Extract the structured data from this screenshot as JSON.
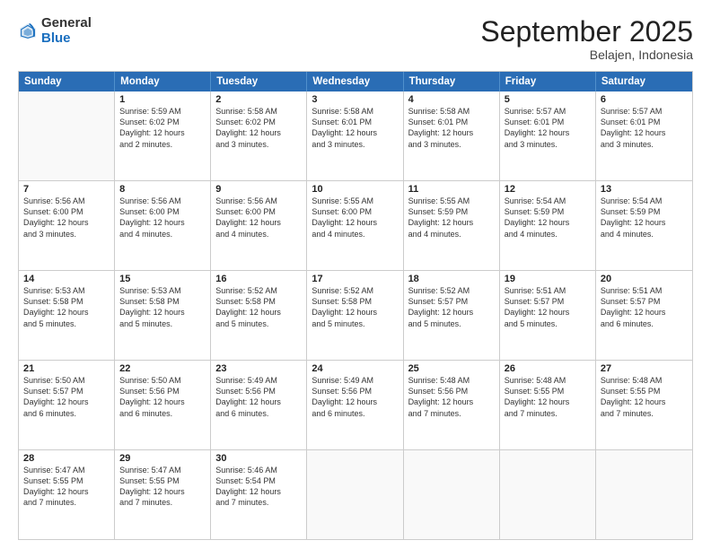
{
  "header": {
    "logo_general": "General",
    "logo_blue": "Blue",
    "title": "September 2025",
    "location": "Belajen, Indonesia"
  },
  "days_of_week": [
    "Sunday",
    "Monday",
    "Tuesday",
    "Wednesday",
    "Thursday",
    "Friday",
    "Saturday"
  ],
  "weeks": [
    [
      {
        "day": "",
        "lines": []
      },
      {
        "day": "1",
        "lines": [
          "Sunrise: 5:59 AM",
          "Sunset: 6:02 PM",
          "Daylight: 12 hours",
          "and 2 minutes."
        ]
      },
      {
        "day": "2",
        "lines": [
          "Sunrise: 5:58 AM",
          "Sunset: 6:02 PM",
          "Daylight: 12 hours",
          "and 3 minutes."
        ]
      },
      {
        "day": "3",
        "lines": [
          "Sunrise: 5:58 AM",
          "Sunset: 6:01 PM",
          "Daylight: 12 hours",
          "and 3 minutes."
        ]
      },
      {
        "day": "4",
        "lines": [
          "Sunrise: 5:58 AM",
          "Sunset: 6:01 PM",
          "Daylight: 12 hours",
          "and 3 minutes."
        ]
      },
      {
        "day": "5",
        "lines": [
          "Sunrise: 5:57 AM",
          "Sunset: 6:01 PM",
          "Daylight: 12 hours",
          "and 3 minutes."
        ]
      },
      {
        "day": "6",
        "lines": [
          "Sunrise: 5:57 AM",
          "Sunset: 6:01 PM",
          "Daylight: 12 hours",
          "and 3 minutes."
        ]
      }
    ],
    [
      {
        "day": "7",
        "lines": [
          "Sunrise: 5:56 AM",
          "Sunset: 6:00 PM",
          "Daylight: 12 hours",
          "and 3 minutes."
        ]
      },
      {
        "day": "8",
        "lines": [
          "Sunrise: 5:56 AM",
          "Sunset: 6:00 PM",
          "Daylight: 12 hours",
          "and 4 minutes."
        ]
      },
      {
        "day": "9",
        "lines": [
          "Sunrise: 5:56 AM",
          "Sunset: 6:00 PM",
          "Daylight: 12 hours",
          "and 4 minutes."
        ]
      },
      {
        "day": "10",
        "lines": [
          "Sunrise: 5:55 AM",
          "Sunset: 6:00 PM",
          "Daylight: 12 hours",
          "and 4 minutes."
        ]
      },
      {
        "day": "11",
        "lines": [
          "Sunrise: 5:55 AM",
          "Sunset: 5:59 PM",
          "Daylight: 12 hours",
          "and 4 minutes."
        ]
      },
      {
        "day": "12",
        "lines": [
          "Sunrise: 5:54 AM",
          "Sunset: 5:59 PM",
          "Daylight: 12 hours",
          "and 4 minutes."
        ]
      },
      {
        "day": "13",
        "lines": [
          "Sunrise: 5:54 AM",
          "Sunset: 5:59 PM",
          "Daylight: 12 hours",
          "and 4 minutes."
        ]
      }
    ],
    [
      {
        "day": "14",
        "lines": [
          "Sunrise: 5:53 AM",
          "Sunset: 5:58 PM",
          "Daylight: 12 hours",
          "and 5 minutes."
        ]
      },
      {
        "day": "15",
        "lines": [
          "Sunrise: 5:53 AM",
          "Sunset: 5:58 PM",
          "Daylight: 12 hours",
          "and 5 minutes."
        ]
      },
      {
        "day": "16",
        "lines": [
          "Sunrise: 5:52 AM",
          "Sunset: 5:58 PM",
          "Daylight: 12 hours",
          "and 5 minutes."
        ]
      },
      {
        "day": "17",
        "lines": [
          "Sunrise: 5:52 AM",
          "Sunset: 5:58 PM",
          "Daylight: 12 hours",
          "and 5 minutes."
        ]
      },
      {
        "day": "18",
        "lines": [
          "Sunrise: 5:52 AM",
          "Sunset: 5:57 PM",
          "Daylight: 12 hours",
          "and 5 minutes."
        ]
      },
      {
        "day": "19",
        "lines": [
          "Sunrise: 5:51 AM",
          "Sunset: 5:57 PM",
          "Daylight: 12 hours",
          "and 5 minutes."
        ]
      },
      {
        "day": "20",
        "lines": [
          "Sunrise: 5:51 AM",
          "Sunset: 5:57 PM",
          "Daylight: 12 hours",
          "and 6 minutes."
        ]
      }
    ],
    [
      {
        "day": "21",
        "lines": [
          "Sunrise: 5:50 AM",
          "Sunset: 5:57 PM",
          "Daylight: 12 hours",
          "and 6 minutes."
        ]
      },
      {
        "day": "22",
        "lines": [
          "Sunrise: 5:50 AM",
          "Sunset: 5:56 PM",
          "Daylight: 12 hours",
          "and 6 minutes."
        ]
      },
      {
        "day": "23",
        "lines": [
          "Sunrise: 5:49 AM",
          "Sunset: 5:56 PM",
          "Daylight: 12 hours",
          "and 6 minutes."
        ]
      },
      {
        "day": "24",
        "lines": [
          "Sunrise: 5:49 AM",
          "Sunset: 5:56 PM",
          "Daylight: 12 hours",
          "and 6 minutes."
        ]
      },
      {
        "day": "25",
        "lines": [
          "Sunrise: 5:48 AM",
          "Sunset: 5:56 PM",
          "Daylight: 12 hours",
          "and 7 minutes."
        ]
      },
      {
        "day": "26",
        "lines": [
          "Sunrise: 5:48 AM",
          "Sunset: 5:55 PM",
          "Daylight: 12 hours",
          "and 7 minutes."
        ]
      },
      {
        "day": "27",
        "lines": [
          "Sunrise: 5:48 AM",
          "Sunset: 5:55 PM",
          "Daylight: 12 hours",
          "and 7 minutes."
        ]
      }
    ],
    [
      {
        "day": "28",
        "lines": [
          "Sunrise: 5:47 AM",
          "Sunset: 5:55 PM",
          "Daylight: 12 hours",
          "and 7 minutes."
        ]
      },
      {
        "day": "29",
        "lines": [
          "Sunrise: 5:47 AM",
          "Sunset: 5:55 PM",
          "Daylight: 12 hours",
          "and 7 minutes."
        ]
      },
      {
        "day": "30",
        "lines": [
          "Sunrise: 5:46 AM",
          "Sunset: 5:54 PM",
          "Daylight: 12 hours",
          "and 7 minutes."
        ]
      },
      {
        "day": "",
        "lines": []
      },
      {
        "day": "",
        "lines": []
      },
      {
        "day": "",
        "lines": []
      },
      {
        "day": "",
        "lines": []
      }
    ]
  ]
}
